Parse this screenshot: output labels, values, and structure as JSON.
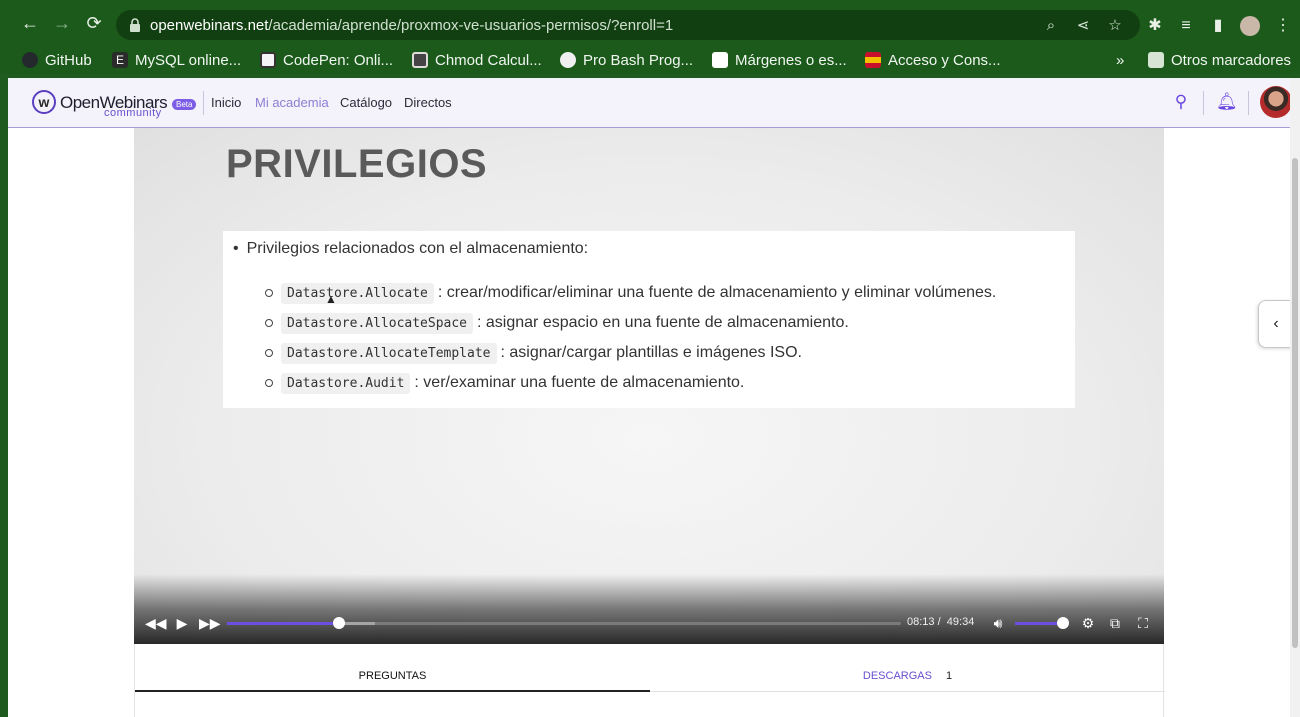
{
  "browser": {
    "url_domain": "openwebinars.net",
    "url_path": "/academia/aprende/proxmox-ve-usuarios-permisos/?enroll=1",
    "bookmarks": [
      {
        "label": "GitHub",
        "color": "#24292e"
      },
      {
        "label": "MySQL online...",
        "color": "#2b2b2b"
      },
      {
        "label": "CodePen: Onli...",
        "color": "#f5f5f5"
      },
      {
        "label": "Chmod Calcul...",
        "color": "#444444"
      },
      {
        "label": "Pro Bash Prog...",
        "color": "#f0f0f0"
      },
      {
        "label": "Márgenes o es...",
        "color": "#ffffff"
      },
      {
        "label": "Acceso y Cons...",
        "color": "#c8102e"
      }
    ],
    "more_bookmarks": "»",
    "other_bookmarks": "Otros marcadores"
  },
  "site": {
    "logo_text": "OpenWebinars",
    "logo_sub": "community",
    "logo_badge": "Beta",
    "nav": [
      {
        "label": "Inicio",
        "active": false
      },
      {
        "label": "Mi academia",
        "active": true
      },
      {
        "label": "Catálogo",
        "active": false
      },
      {
        "label": "Directos",
        "active": false
      }
    ]
  },
  "slide": {
    "title": "PRIVILEGIOS",
    "main_point": "Privilegios relacionados con el almacenamiento:",
    "items": [
      {
        "code": "Datastore.Allocate",
        "text": ": crear/modificar/eliminar una fuente de almacenamiento y eliminar volúmenes."
      },
      {
        "code": "Datastore.AllocateSpace",
        "text": ": asignar espacio en una fuente de almacenamiento."
      },
      {
        "code": "Datastore.AllocateTemplate",
        "text": ": asignar/cargar plantillas e imágenes ISO."
      },
      {
        "code": "Datastore.Audit",
        "text": ": ver/examinar una fuente de almacenamiento."
      }
    ]
  },
  "player": {
    "current_time": "08:13",
    "separator": "/",
    "duration": "49:34",
    "progress_fraction": 0.1656,
    "buffered_fraction": 0.22,
    "volume_fraction": 0.96,
    "accent_color": "#6c4fe0"
  },
  "tabs": [
    {
      "label": "PREGUNTAS",
      "count": ""
    },
    {
      "label": "DESCARGAS",
      "count": "1"
    }
  ]
}
